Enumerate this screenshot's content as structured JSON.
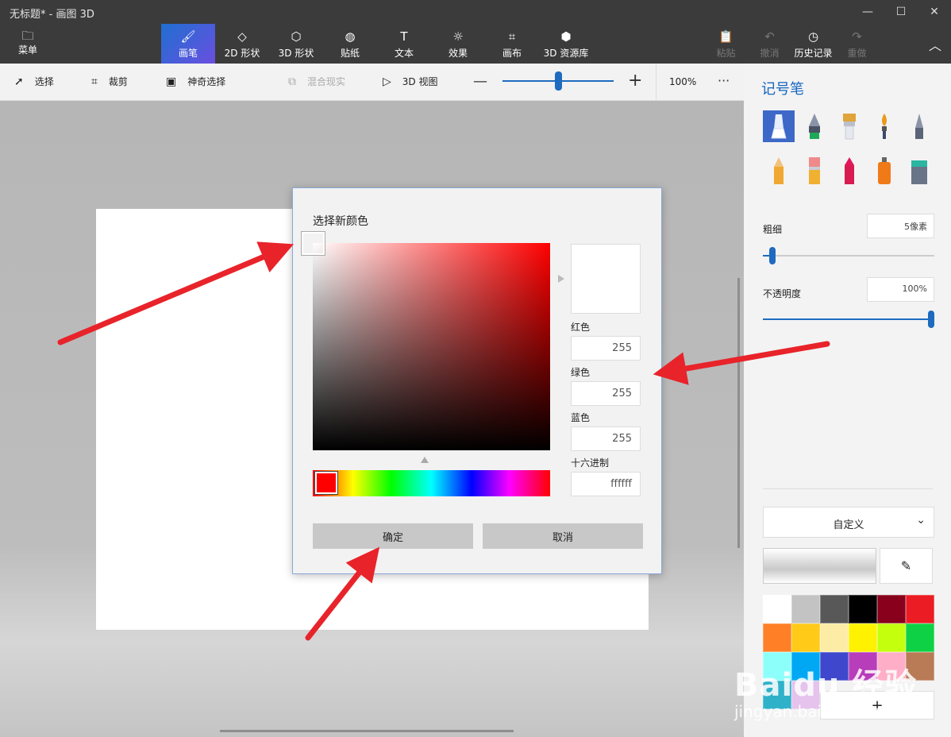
{
  "window": {
    "title": "无标题* - 画图 3D",
    "minimize_icon": "minimize-icon",
    "maximize_icon": "maximize-icon",
    "close_icon": "close-icon"
  },
  "ribbon": {
    "menu_label": "菜单",
    "tabs": [
      {
        "label": "画笔",
        "icon": "brush-icon",
        "active": true
      },
      {
        "label": "2D 形状",
        "icon": "shapes-2d-icon"
      },
      {
        "label": "3D 形状",
        "icon": "cube-icon"
      },
      {
        "label": "贴纸",
        "icon": "sticker-icon"
      },
      {
        "label": "文本",
        "icon": "text-icon"
      },
      {
        "label": "效果",
        "icon": "effects-icon"
      },
      {
        "label": "画布",
        "icon": "canvas-icon"
      },
      {
        "label": "3D 资源库",
        "icon": "library-3d-icon"
      }
    ],
    "right_tools": [
      {
        "label": "粘贴",
        "icon": "paste-icon",
        "disabled": true
      },
      {
        "label": "撤消",
        "icon": "undo-icon",
        "disabled": true
      },
      {
        "label": "历史记录",
        "icon": "history-icon",
        "disabled": false
      },
      {
        "label": "重做",
        "icon": "redo-icon",
        "disabled": true
      }
    ]
  },
  "toolbar": {
    "select": "选择",
    "crop": "裁剪",
    "magic_select": "神奇选择",
    "mixed_reality": "混合现实",
    "view_3d": "3D 视图",
    "zoom_minus": "—",
    "zoom_plus": "+",
    "zoom_level": "100%",
    "more": "···"
  },
  "side_panel": {
    "title": "记号笔",
    "thickness_label": "粗细",
    "thickness_value": "5像素",
    "opacity_label": "不透明度",
    "opacity_value": "100%",
    "color_mode": "自定义",
    "add_color": "+",
    "swatch_colors": [
      "#ffffff",
      "#c3c3c3",
      "#585858",
      "#000000",
      "#88001b",
      "#ec1c24",
      "#ff7f27",
      "#ffca18",
      "#fdeca6",
      "#fff200",
      "#c4ff0e",
      "#0ed145",
      "#8cfffb",
      "#00a8f3",
      "#3f48cc",
      "#b83dba",
      "#ffaec8",
      "#b97a56",
      "#2fb1c9",
      "#e5c3ec"
    ]
  },
  "dialog": {
    "title": "选择新颜色",
    "red_label": "红色",
    "red_value": "255",
    "green_label": "绿色",
    "green_value": "255",
    "blue_label": "蓝色",
    "blue_value": "255",
    "hex_label": "十六进制",
    "hex_value": "ffffff",
    "ok": "确定",
    "cancel": "取消"
  },
  "watermark": {
    "brand": "Baidu 经验",
    "url": "jingyan.baidu.com"
  }
}
